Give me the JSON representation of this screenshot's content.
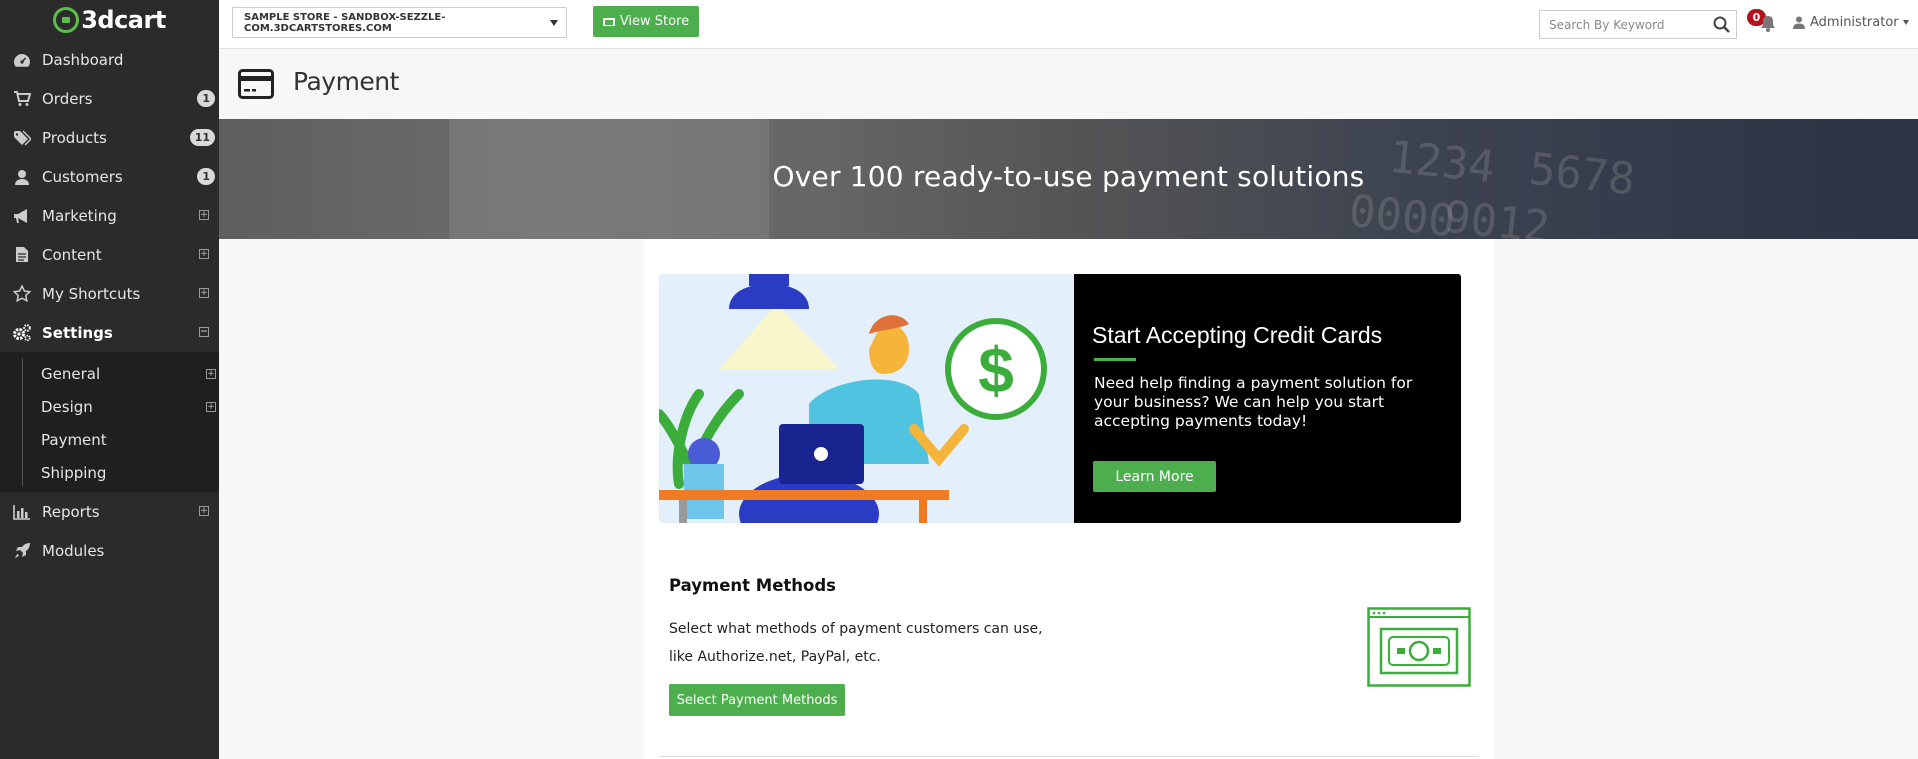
{
  "brand": {
    "logo_text": "3dcart",
    "accent": "#4cae4c"
  },
  "sidebar": {
    "items": [
      {
        "label": "Dashboard",
        "icon": "dashboard-icon"
      },
      {
        "label": "Orders",
        "icon": "cart-icon",
        "badge": "1"
      },
      {
        "label": "Products",
        "icon": "tags-icon",
        "badge": "11"
      },
      {
        "label": "Customers",
        "icon": "user-icon",
        "badge": "1"
      },
      {
        "label": "Marketing",
        "icon": "megaphone-icon",
        "expand": "+"
      },
      {
        "label": "Content",
        "icon": "document-icon",
        "expand": "+"
      },
      {
        "label": "My Shortcuts",
        "icon": "star-icon",
        "expand": "+"
      },
      {
        "label": "Settings",
        "icon": "cogs-icon",
        "expand": "−"
      }
    ],
    "settings_sub": [
      {
        "label": "General",
        "expand": "+"
      },
      {
        "label": "Design",
        "expand": "+"
      },
      {
        "label": "Payment"
      },
      {
        "label": "Shipping"
      }
    ],
    "bottom_items": [
      {
        "label": "Reports",
        "icon": "bar-chart-icon",
        "expand": "+"
      },
      {
        "label": "Modules",
        "icon": "rocket-icon"
      }
    ]
  },
  "topbar": {
    "store_select": "SAMPLE STORE - SANDBOX-SEZZLE-COM.3DCARTSTORES.COM",
    "view_store": "View Store",
    "search_placeholder": "Search By Keyword",
    "notification_count": "0",
    "user": "Administrator"
  },
  "page": {
    "title": "Payment"
  },
  "banner": {
    "headline": "Over 100 ready-to-use payment solutions"
  },
  "promo": {
    "title": "Start Accepting Credit Cards",
    "text": "Need help finding a payment solution for your business? We can help you start accepting payments today!",
    "button": "Learn More"
  },
  "payment_methods": {
    "title": "Payment Methods",
    "description": "Select what methods of payment customers can use, like Authorize.net, PayPal, etc.",
    "button": "Select Payment Methods"
  }
}
